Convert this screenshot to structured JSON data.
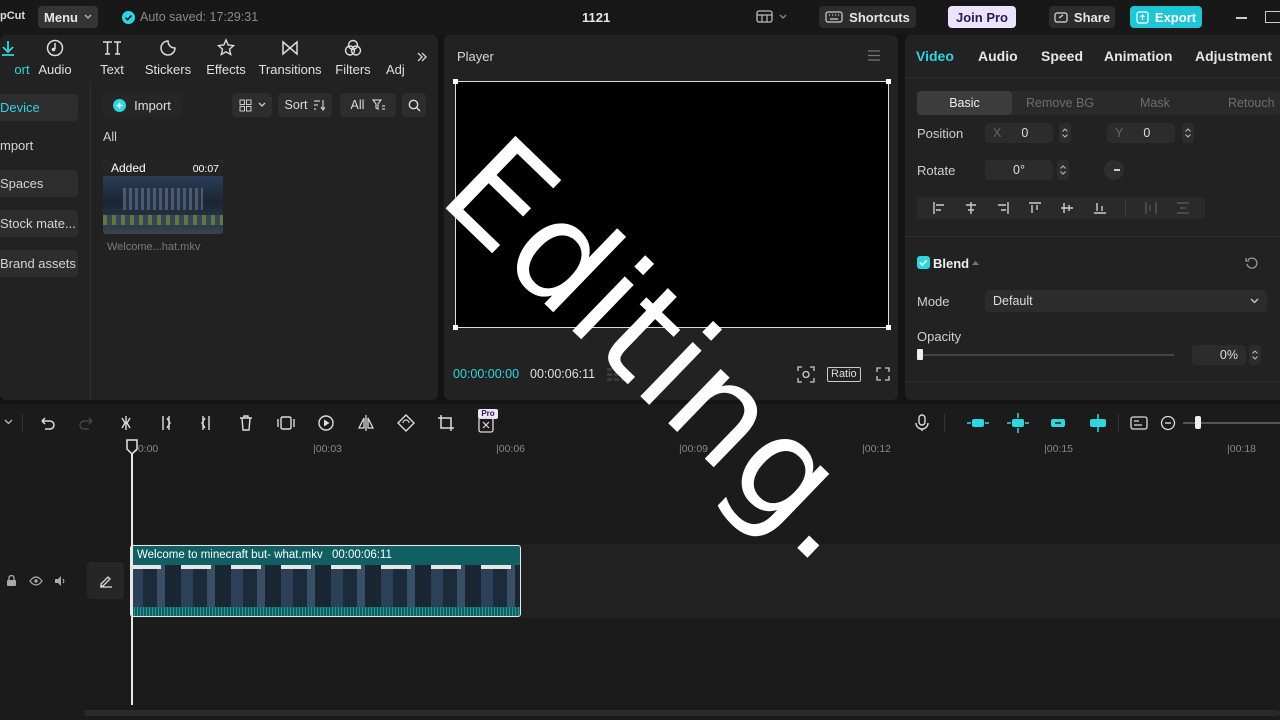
{
  "topbar": {
    "app_name": "pCut",
    "menu_label": "Menu",
    "autosave_text": "Auto saved: 17:29:31",
    "project_name": "1121",
    "shortcuts_label": "Shortcuts",
    "join_pro_label": "Join Pro",
    "share_label": "Share",
    "export_label": "Export"
  },
  "media_tabs": [
    {
      "label": "ort",
      "icon": "import-icon"
    },
    {
      "label": "Audio",
      "icon": "audio-icon"
    },
    {
      "label": "Text",
      "icon": "text-icon"
    },
    {
      "label": "Stickers",
      "icon": "stickers-icon"
    },
    {
      "label": "Effects",
      "icon": "effects-icon"
    },
    {
      "label": "Transitions",
      "icon": "transitions-icon"
    },
    {
      "label": "Filters",
      "icon": "filters-icon"
    },
    {
      "label": "Adj",
      "icon": "adjustment-icon"
    }
  ],
  "sidebar": {
    "items": [
      {
        "label": "Device"
      },
      {
        "label": "mport"
      },
      {
        "label": "Spaces"
      },
      {
        "label": "Stock mate..."
      },
      {
        "label": "Brand assets"
      }
    ]
  },
  "media": {
    "import_label": "Import",
    "sort_label": "Sort",
    "all_filter_label": "All",
    "section_label": "All",
    "clip": {
      "badge": "Added",
      "duration": "00:07",
      "name": "Welcome...hat.mkv"
    }
  },
  "player": {
    "title": "Player",
    "current_time": "00:00:00:00",
    "total_time": "00:00:06:11",
    "ratio_label": "Ratio"
  },
  "overlay_text": "Editing.",
  "properties": {
    "tabs": [
      "Video",
      "Audio",
      "Speed",
      "Animation",
      "Adjustment"
    ],
    "active_tab": "Video",
    "subtabs": [
      "Basic",
      "Remove BG",
      "Mask",
      "Retouch"
    ],
    "position_label": "Position",
    "x_label": "X",
    "x_value": "0",
    "y_label": "Y",
    "y_value": "0",
    "rotate_label": "Rotate",
    "rotate_value": "0°",
    "blend_label": "Blend",
    "mode_label": "Mode",
    "mode_value": "Default",
    "opacity_label": "Opacity",
    "opacity_value": "0%"
  },
  "timeline": {
    "ticks": [
      "00:00",
      "|00:03",
      "|00:06",
      "|00:09",
      "|00:12",
      "|00:15",
      "|00:18"
    ],
    "clip_title": "Welcome to minecraft but- what.mkv",
    "clip_duration": "00:00:06:11",
    "pro_badge": "Pro"
  },
  "colors": {
    "accent": "#2fd6e0",
    "export": "#1fc6d6",
    "clip_bg": "#0f5f63",
    "playhead": "#e8e8e8"
  }
}
